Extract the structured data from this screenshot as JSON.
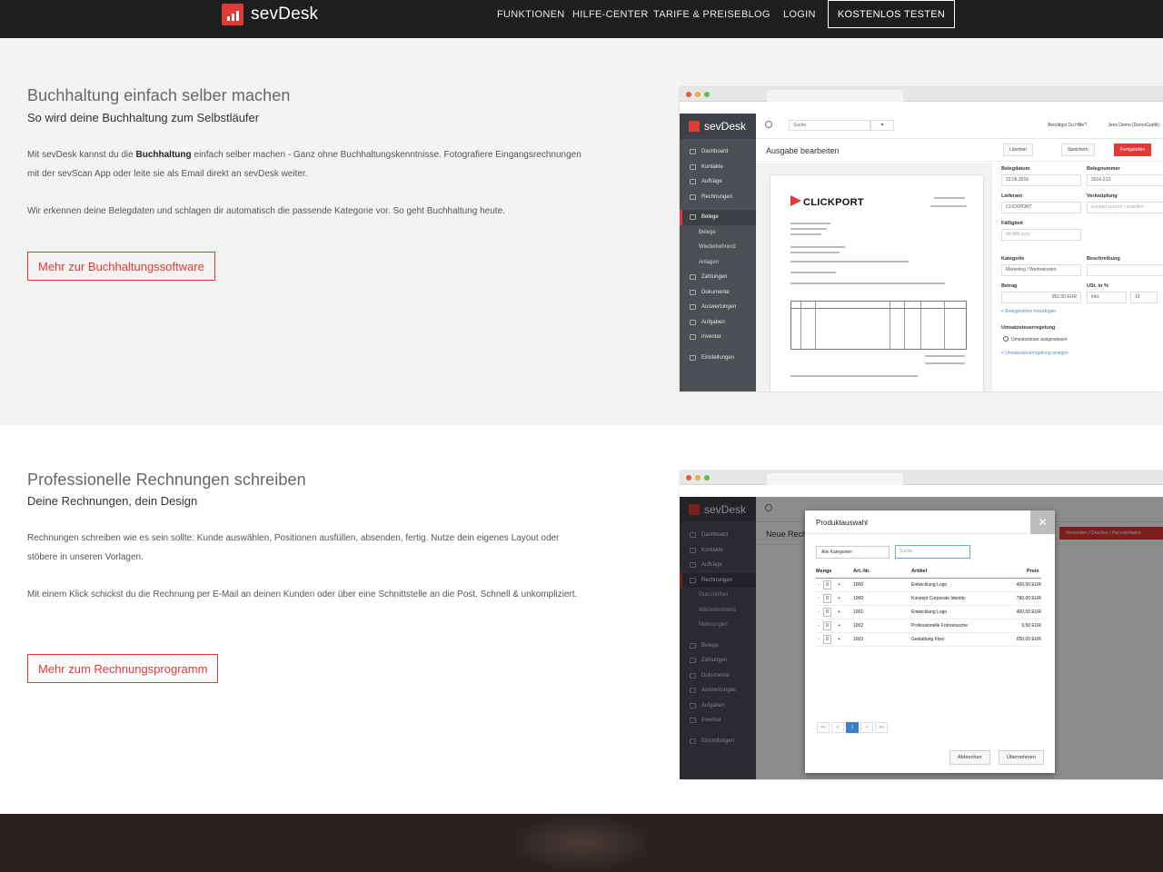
{
  "nav": {
    "brand": "sevDesk",
    "links": [
      "FUNKTIONEN",
      "HILFE-CENTER",
      "TARIFE & PREISE",
      "BLOG",
      "LOGIN"
    ],
    "cta": "KOSTENLOS TESTEN"
  },
  "section1": {
    "title": "Buchhaltung einfach selber machen",
    "subtitle": "So wird deine Buchhaltung zum Selbstläufer",
    "p1_before": "Mit sevDesk kannst du die ",
    "p1_bold": "Buchhaltung",
    "p1_after": " einfach selber machen - Ganz ohne Buchhaltungskenntnisse. Fotografiere Eingangsrechnungen mit der sevScan App oder leite sie als Email direkt an sevDesk weiter.",
    "p2": "Wir erkennen deine Belegdaten und schlagen dir automatisch die passende Kategorie vor. So geht Buchhaltung heute.",
    "button": "Mehr zur Buchhaltungssoftware"
  },
  "section2": {
    "title": "Professionelle Rechnungen schreiben",
    "subtitle": "Deine Rechnungen, dein Design",
    "p1": "Rechnungen schreiben wie es sein sollte: Kunde auswählen, Positionen ausfüllen, absenden, fertig. Nutze dein eigenes Layout oder stöbere in unseren Vorlagen.",
    "p2": "Mit einem Klick schickst du die Rechnung per E-Mail an deinen Kunden oder über eine Schnittstelle an die Post. Schnell & unkompliziert.",
    "button": "Mehr zum Rechnungsprogramm"
  },
  "app1": {
    "brand": "sevDesk",
    "sidebar": [
      {
        "label": "Dashboard",
        "type": "main"
      },
      {
        "label": "Kontakte",
        "type": "main"
      },
      {
        "label": "Aufträge",
        "type": "main"
      },
      {
        "label": "Rechnungen",
        "type": "main"
      },
      {
        "label": "Belege",
        "type": "active"
      },
      {
        "label": "Belege",
        "type": "sub"
      },
      {
        "label": "Wiederkehrend",
        "type": "sub"
      },
      {
        "label": "Anlagen",
        "type": "sub"
      },
      {
        "label": "Zahlungen",
        "type": "main"
      },
      {
        "label": "Dokumente",
        "type": "main"
      },
      {
        "label": "Auswertungen",
        "type": "main"
      },
      {
        "label": "Aufgaben",
        "type": "main"
      },
      {
        "label": "Inventar",
        "type": "main"
      },
      {
        "label": "Einstellungen",
        "type": "main"
      }
    ],
    "search_placeholder": "Suche",
    "help": "Benötigst Du Hilfe?",
    "user": "Jens Demo (DemoGrafik)",
    "page_title": "Ausgabe bearbeiten",
    "btn_delete": "Löschen",
    "btn_save": "Speichern",
    "btn_finish": "Fertigstellen",
    "doc_brand": "CLICKPORT",
    "form": {
      "belegdatum_label": "Belegdatum",
      "belegdatum": "23.06.2016",
      "belegnummer_label": "Belegnummer",
      "belegnummer": "2016-213",
      "lieferant_label": "Lieferant",
      "lieferant": "CLICKPORT",
      "verknuepfung_label": "Verknüpfung",
      "verknuepfung": "Kontakt suchen / erstellen",
      "faelligkeit_label": "Fälligkeit",
      "faelligkeit": "dd.MM.yyyy",
      "kategorie_label": "Kategorie",
      "kategorie": "Marketing / Werbekosten",
      "beschreibung_label": "Beschreibung",
      "betrag_label": "Betrag",
      "betrag": "952,00 EUR",
      "ust_label": "USt. in %",
      "ust_mode": "Inkl.",
      "ust": "19",
      "add_position": "+ Belegposition hinzufügen",
      "ust_rule_label": "Umsatzsteuerregelung",
      "ust_rule": "Umsatzsteuer ausgewiesen",
      "ust_rule_link": "+ Umsatzsteuerregelung anlegen"
    }
  },
  "app2": {
    "brand": "sevDesk",
    "page_title": "Neue Rech",
    "send_btn": "Versenden / Drucken / Herunterladen",
    "sidebar": [
      "Dashboard",
      "Kontakte",
      "Aufträge",
      "Rechnungen",
      "Gutschriften",
      "Wiederkehrend",
      "Mahnungen",
      "Belege",
      "Zahlungen",
      "Dokumente",
      "Auswertungen",
      "Aufgaben",
      "Inventar",
      "Einstellungen"
    ],
    "modal": {
      "title": "Produktauswahl",
      "category": "Alle Kategorien",
      "search_placeholder": "Suche",
      "headers": [
        "Menge",
        "Art.-Nr.",
        "Artikel",
        "Preis"
      ],
      "rows": [
        {
          "qty": "0",
          "nr": "1000",
          "article": "Entwicklung Logo",
          "price": "400,00 EUR"
        },
        {
          "qty": "0",
          "nr": "1000",
          "article": "Konzept Corporate Identity",
          "price": "790,00 EUR"
        },
        {
          "qty": "0",
          "nr": "1001",
          "article": "Entwicklung Logo",
          "price": "400,00 EUR"
        },
        {
          "qty": "0",
          "nr": "1002",
          "article": "Professionelle Fotoretusche",
          "price": "9,50 EUR"
        },
        {
          "qty": "0",
          "nr": "1003",
          "article": "Gestaltung Flyer",
          "price": "650,00 EUR"
        }
      ],
      "pager": [
        "<<",
        "<",
        "1",
        ">",
        ">>"
      ],
      "cancel": "Abbrechen",
      "confirm": "Übernehmen"
    }
  }
}
